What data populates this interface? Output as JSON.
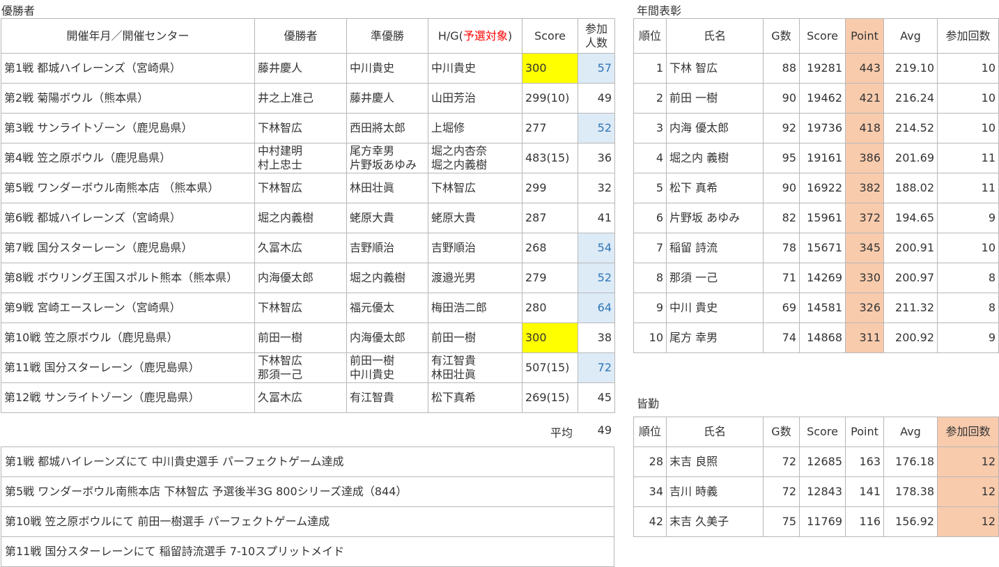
{
  "winners_section": {
    "title": "優勝者",
    "headers": {
      "event": "開催年月／開催センター",
      "winner": "優勝者",
      "runner_up": "準優勝",
      "hg_prefix": "H/G(",
      "hg_red": "予選対象",
      "hg_suffix": ")",
      "score": "Score",
      "participants_1": "参加",
      "participants_2": "人数"
    },
    "rows": [
      {
        "event": "第1戦 都城ハイレーンズ（宮崎県）",
        "winner": [
          "藤井慶人"
        ],
        "runner_up": [
          "中川貴史"
        ],
        "hg": [
          "中川貴史"
        ],
        "score": "300",
        "score_hl": "yellow",
        "participants": "57",
        "part_hl": "blue"
      },
      {
        "event": "第2戦 菊陽ボウル（熊本県）",
        "winner": [
          "井之上准己"
        ],
        "runner_up": [
          "藤井慶人"
        ],
        "hg": [
          "山田芳治"
        ],
        "score": "299(10)",
        "score_hl": "",
        "participants": "49",
        "part_hl": ""
      },
      {
        "event": "第3戦 サンライトゾーン（鹿児島県）",
        "winner": [
          "下林智広"
        ],
        "runner_up": [
          "西田將太郎"
        ],
        "hg": [
          "上堀修"
        ],
        "score": "277",
        "score_hl": "",
        "participants": "52",
        "part_hl": "blue"
      },
      {
        "event": "第4戦 笠之原ボウル（鹿児島県）",
        "winner": [
          "中村建明",
          "村上忠士"
        ],
        "runner_up": [
          "尾方幸男",
          "片野坂あゆみ"
        ],
        "hg": [
          "堀之内杏奈",
          "堀之内義樹"
        ],
        "score": "483(15)",
        "score_hl": "",
        "participants": "36",
        "part_hl": ""
      },
      {
        "event": "第5戦 ワンダーボウル南熊本店 （熊本県）",
        "winner": [
          "下林智広"
        ],
        "runner_up": [
          "林田壮眞"
        ],
        "hg": [
          "下林智広"
        ],
        "score": "299",
        "score_hl": "",
        "participants": "32",
        "part_hl": ""
      },
      {
        "event": "第6戦 都城ハイレーンズ（宮崎県）",
        "winner": [
          "堀之内義樹"
        ],
        "runner_up": [
          "蛯原大貴"
        ],
        "hg": [
          "蛯原大貴"
        ],
        "score": "287",
        "score_hl": "",
        "participants": "41",
        "part_hl": ""
      },
      {
        "event": "第7戦 国分スターレーン（鹿児島県）",
        "winner": [
          "久冨木広"
        ],
        "runner_up": [
          "吉野順治"
        ],
        "hg": [
          "吉野順治"
        ],
        "score": "268",
        "score_hl": "",
        "participants": "54",
        "part_hl": "blue"
      },
      {
        "event": "第8戦 ボウリング王国スポルト熊本（熊本県）",
        "winner": [
          "内海優太郎"
        ],
        "runner_up": [
          "堀之内義樹"
        ],
        "hg": [
          "渡邉光男"
        ],
        "score": "279",
        "score_hl": "",
        "participants": "52",
        "part_hl": "blue"
      },
      {
        "event": "第9戦 宮崎エースレーン（宮崎県）",
        "winner": [
          "下林智広"
        ],
        "runner_up": [
          "福元優太"
        ],
        "hg": [
          "梅田浩二郎"
        ],
        "score": "280",
        "score_hl": "",
        "participants": "64",
        "part_hl": "blue"
      },
      {
        "event": "第10戦 笠之原ボウル（鹿児島県）",
        "winner": [
          "前田一樹"
        ],
        "runner_up": [
          "内海優太郎"
        ],
        "hg": [
          "前田一樹"
        ],
        "score": "300",
        "score_hl": "yellow",
        "participants": "38",
        "part_hl": ""
      },
      {
        "event": "第11戦 国分スターレーン（鹿児島県）",
        "winner": [
          "下林智広",
          "那須一己"
        ],
        "runner_up": [
          "前田一樹",
          "中川貴史"
        ],
        "hg": [
          "有江智貴",
          "林田壮眞"
        ],
        "score": "507(15)",
        "score_hl": "",
        "participants": "72",
        "part_hl": "blue"
      },
      {
        "event": "第12戦 サンライトゾーン（鹿児島県）",
        "winner": [
          "久冨木広"
        ],
        "runner_up": [
          "有江智貴"
        ],
        "hg": [
          "松下真希"
        ],
        "score": "269(15)",
        "score_hl": "",
        "participants": "45",
        "part_hl": ""
      }
    ],
    "average_label": "平均",
    "average_value": "49"
  },
  "notes": [
    "第1戦 都城ハイレーンズにて 中川貴史選手 パーフェクトゲーム達成",
    "第5戦 ワンダーボウル南熊本店 下林智広 予選後半3G 800シリーズ達成（844）",
    "第10戦 笠之原ボウルにて 前田一樹選手 パーフェクトゲーム達成",
    "第11戦 国分スターレーンにて 稲留詩流選手 7-10スプリットメイド"
  ],
  "annual_section": {
    "title": "年間表彰",
    "headers": {
      "rank": "順位",
      "name": "氏名",
      "games": "G数",
      "score": "Score",
      "point": "Point",
      "avg": "Avg",
      "count": "参加回数"
    },
    "highlight_color": "#f8cbad",
    "rows": [
      {
        "rank": "1",
        "name": "下林 智広",
        "games": "88",
        "score": "19281",
        "point": "443",
        "avg": "219.10",
        "count": "10"
      },
      {
        "rank": "2",
        "name": "前田 一樹",
        "games": "90",
        "score": "19462",
        "point": "421",
        "avg": "216.24",
        "count": "10"
      },
      {
        "rank": "3",
        "name": "内海 優太郎",
        "games": "92",
        "score": "19736",
        "point": "418",
        "avg": "214.52",
        "count": "10"
      },
      {
        "rank": "4",
        "name": "堀之内 義樹",
        "games": "95",
        "score": "19161",
        "point": "386",
        "avg": "201.69",
        "count": "11"
      },
      {
        "rank": "5",
        "name": "松下 真希",
        "games": "90",
        "score": "16922",
        "point": "382",
        "avg": "188.02",
        "count": "11"
      },
      {
        "rank": "6",
        "name": "片野坂 あゆみ",
        "games": "82",
        "score": "15961",
        "point": "372",
        "avg": "194.65",
        "count": "9"
      },
      {
        "rank": "7",
        "name": "稲留 詩流",
        "games": "78",
        "score": "15671",
        "point": "345",
        "avg": "200.91",
        "count": "10"
      },
      {
        "rank": "8",
        "name": "那須 一己",
        "games": "71",
        "score": "14269",
        "point": "330",
        "avg": "200.97",
        "count": "8"
      },
      {
        "rank": "9",
        "name": "中川 貴史",
        "games": "69",
        "score": "14581",
        "point": "326",
        "avg": "211.32",
        "count": "8"
      },
      {
        "rank": "10",
        "name": "尾方 幸男",
        "games": "74",
        "score": "14868",
        "point": "311",
        "avg": "200.92",
        "count": "9"
      }
    ]
  },
  "attendance_section": {
    "title": "皆勤",
    "headers": {
      "rank": "順位",
      "name": "氏名",
      "games": "G数",
      "score": "Score",
      "point": "Point",
      "avg": "Avg",
      "count": "参加回数"
    },
    "rows": [
      {
        "rank": "28",
        "name": "末吉 良照",
        "games": "72",
        "score": "12685",
        "point": "163",
        "avg": "176.18",
        "count": "12"
      },
      {
        "rank": "34",
        "name": "吉川 時義",
        "games": "72",
        "score": "12843",
        "point": "141",
        "avg": "178.38",
        "count": "12"
      },
      {
        "rank": "42",
        "name": "末吉 久美子",
        "games": "75",
        "score": "11769",
        "point": "116",
        "avg": "156.92",
        "count": "12"
      }
    ]
  },
  "colors": {
    "perfect_yellow": "#ffff00",
    "participants_blue_bg": "#ddebf7",
    "participants_blue_text": "#2f75b5",
    "qualifier_red": "#ff0000"
  }
}
